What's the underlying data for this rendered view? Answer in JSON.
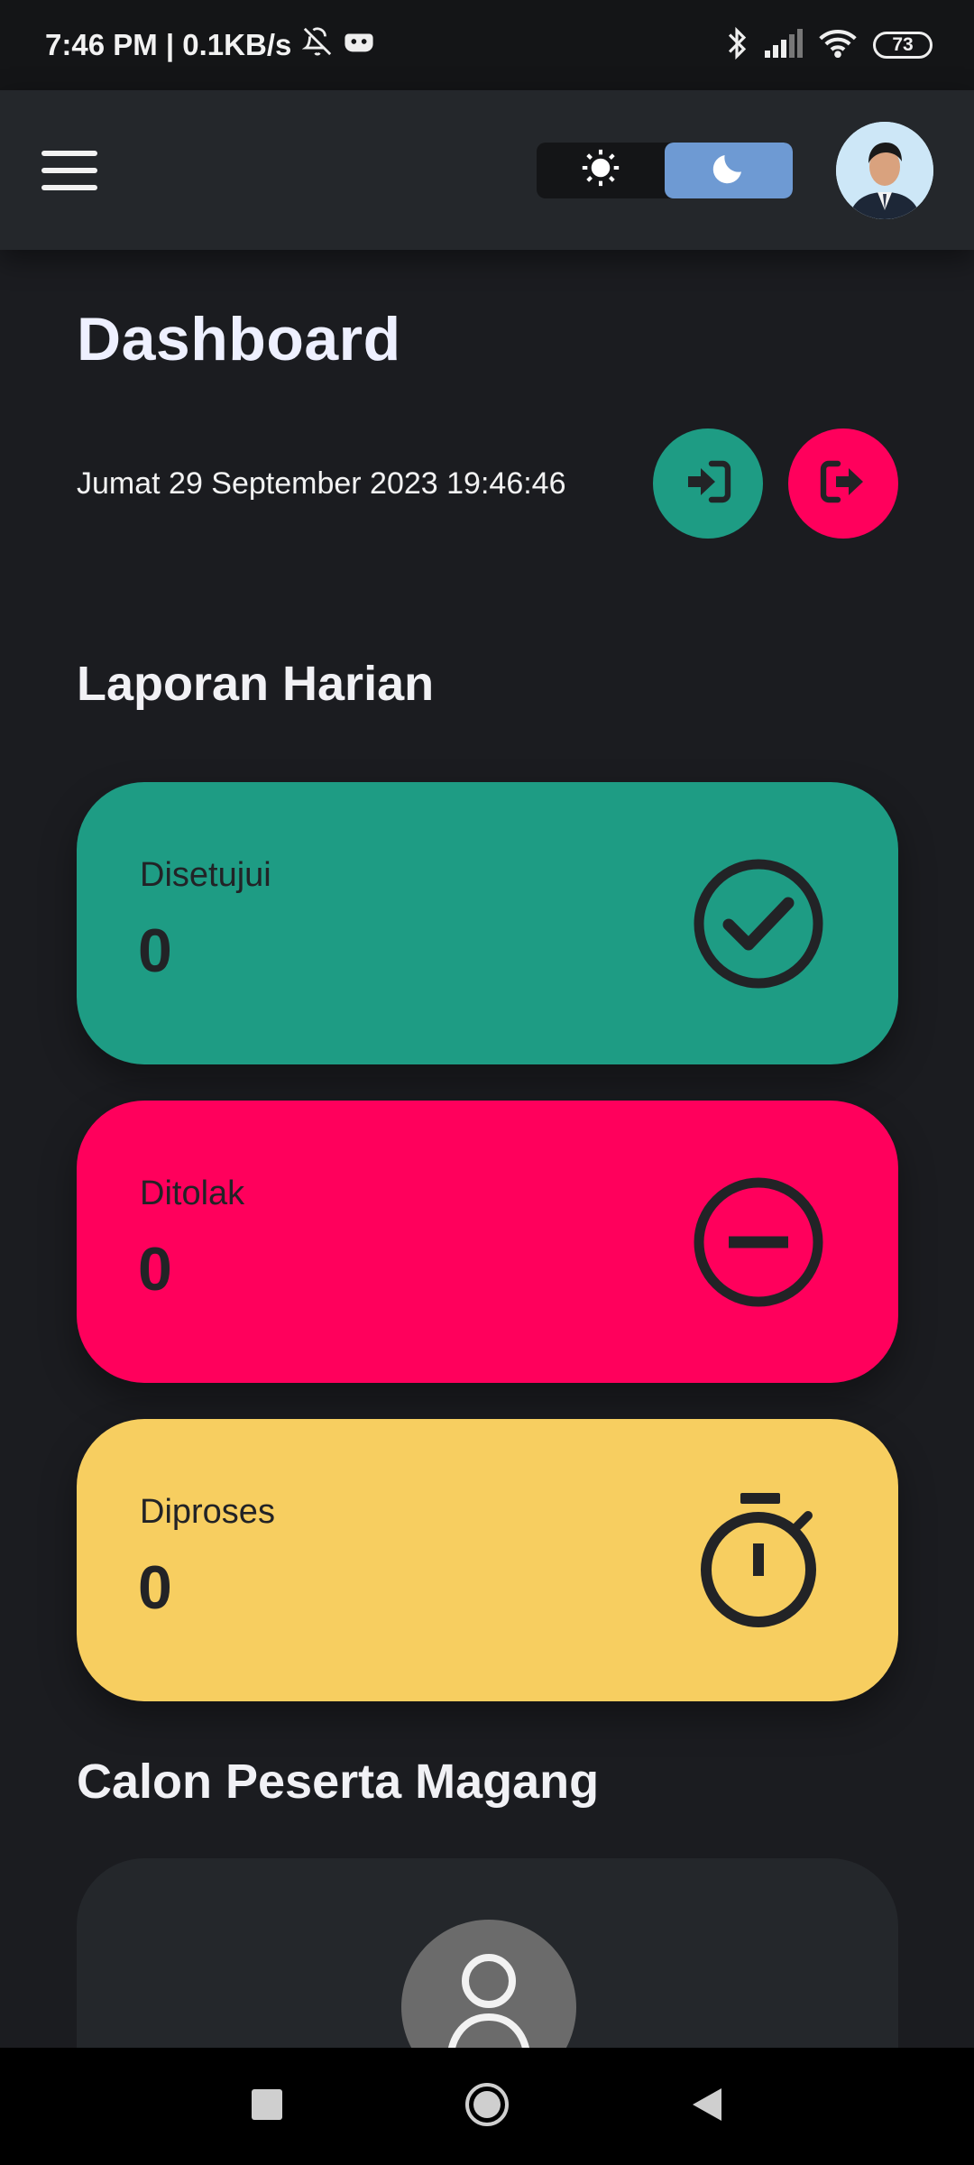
{
  "status_bar": {
    "time_network": "7:46 PM | 0.1KB/s",
    "battery": "73"
  },
  "app_bar": {
    "menu_icon": "hamburger-menu-icon",
    "theme_toggle": {
      "light_icon": "sun-icon",
      "dark_icon": "moon-icon",
      "active": "dark"
    }
  },
  "page": {
    "title": "Dashboard",
    "datetime": "Jumat 29 September 2023 19:46:46"
  },
  "attendance": {
    "checkin_icon": "sign-in-icon",
    "checkout_icon": "sign-out-icon",
    "checkin_color": "#1e9c84",
    "checkout_color": "#ff005c"
  },
  "daily_report": {
    "title": "Laporan Harian",
    "cards": [
      {
        "label": "Disetujui",
        "value": "0",
        "icon": "check-circle-icon",
        "color": "#1e9c84"
      },
      {
        "label": "Ditolak",
        "value": "0",
        "icon": "minus-circle-icon",
        "color": "#ff005c"
      },
      {
        "label": "Diproses",
        "value": "0",
        "icon": "stopwatch-icon",
        "color": "#f7ce60"
      }
    ]
  },
  "candidates": {
    "title": "Calon Peserta Magang"
  },
  "nav_bar": {
    "recents_icon": "square-icon",
    "home_icon": "circle-icon",
    "back_icon": "back-triangle-icon"
  }
}
